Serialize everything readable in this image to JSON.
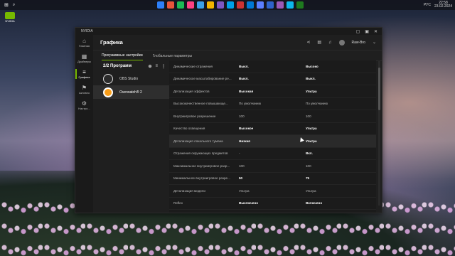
{
  "desktop": {
    "icon_label": "NVIDIA",
    "icon_sublabel": "App"
  },
  "taskbar": {
    "apps": [
      "#2d7ff9",
      "#e8553b",
      "#1db954",
      "#ff4081",
      "#3ca0e8",
      "#f4b400",
      "#7e57c2",
      "#00a0e8",
      "#cc3333",
      "#0078d4",
      "#5b7fff",
      "#2f63c9",
      "#9b59b6",
      "#0db7ed",
      "#1f7a1f"
    ],
    "lang": "РУС",
    "time": "22:58",
    "date": "23.02.2024"
  },
  "window": {
    "app_name": "NVIDIA",
    "controls": [
      "▢",
      "▣",
      "✕"
    ],
    "sidebar": [
      {
        "icon": "⌂",
        "label": "Главная"
      },
      {
        "icon": "▦",
        "label": "Драйверы"
      },
      {
        "icon": "≡",
        "label": "Графика"
      },
      {
        "icon": "⚑",
        "label": "Активно"
      },
      {
        "icon": "⚙",
        "label": "Настро..."
      }
    ],
    "header": {
      "title": "Графика",
      "user": "Raw-Bro"
    },
    "tabs": [
      "Программные настройки",
      "Глобальные параметры"
    ],
    "programs": {
      "heading": "2/2 Программ",
      "items": [
        "OBS Studio",
        "Overwatch® 2"
      ]
    },
    "settings": [
      {
        "name": "Динамические отражения",
        "v1": "Выкл.",
        "v2": "Высоко",
        "b1": true,
        "b2": true
      },
      {
        "name": "Динамическое масштабирование ре...",
        "v1": "Выкл.",
        "v2": "Выкл.",
        "b1": true,
        "b2": true
      },
      {
        "name": "Детализация эффектов",
        "v1": "Высокая",
        "v2": "Ультра",
        "b1": true,
        "b2": true
      },
      {
        "name": "Высококачественное повышающе...",
        "v1": "По умолчанию",
        "v2": "По умолчанию",
        "b1": false,
        "b2": false
      },
      {
        "name": "Внутриигровое разрешение",
        "v1": "100",
        "v2": "100",
        "b1": false,
        "b2": false
      },
      {
        "name": "Качество освещения",
        "v1": "Высокое",
        "v2": "Ультра",
        "b1": true,
        "b2": true
      },
      {
        "name": "Детализация локального тумана",
        "v1": "Низкая",
        "v2": "Ультра",
        "b1": true,
        "b2": true
      },
      {
        "name": "Отражения окружающих предметов",
        "v1": "-",
        "v2": "Вкл.",
        "b1": false,
        "b2": true
      },
      {
        "name": "Максимальное внутриигровое разр...",
        "v1": "100",
        "v2": "100",
        "b1": false,
        "b2": false
      },
      {
        "name": "Минимальное внутриигровое разре...",
        "v1": "50",
        "v2": "75",
        "b1": true,
        "b2": true
      },
      {
        "name": "Детализация модели",
        "v1": "Ультра",
        "v2": "Ультра",
        "b1": false,
        "b2": false
      },
      {
        "name": "Reflex",
        "v1": "Выключено",
        "v2": "Включено",
        "b1": true,
        "b2": true
      }
    ],
    "highlighted_row": 6,
    "accent": "#76b900"
  }
}
